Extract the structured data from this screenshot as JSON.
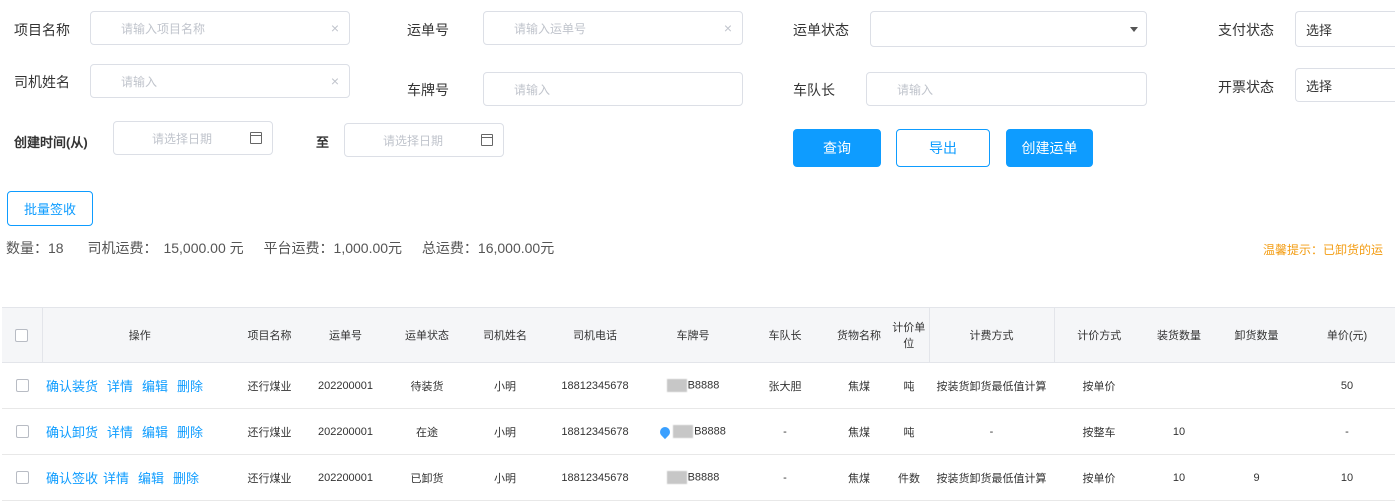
{
  "filters": {
    "project_name": {
      "label": "项目名称",
      "placeholder": "请输入项目名称"
    },
    "waybill_no": {
      "label": "运单号",
      "placeholder": "请输入运单号"
    },
    "waybill_status": {
      "label": "运单状态",
      "value": ""
    },
    "pay_status": {
      "label": "支付状态",
      "value": "选择"
    },
    "driver_name": {
      "label": "司机姓名",
      "placeholder": "请输入"
    },
    "plate_no": {
      "label": "车牌号",
      "placeholder": "请输入"
    },
    "team_leader": {
      "label": "车队长",
      "placeholder": "请输入"
    },
    "invoice_status": {
      "label": "开票状态",
      "value": "选择"
    },
    "created_from": {
      "label": "创建时间(从)",
      "placeholder": "请选择日期"
    },
    "to_label": "至",
    "created_to": {
      "placeholder": "请选择日期"
    },
    "clear_glyph": "×"
  },
  "buttons": {
    "query": "查询",
    "export": "导出",
    "create": "创建运单",
    "batch_sign": "批量签收"
  },
  "summary": {
    "count_label": "数量：",
    "count": "18",
    "driver_fee_label": "司机运费：",
    "driver_fee": "15,000.00 元",
    "platform_fee_label": "平台运费：",
    "platform_fee": "1,000.00元",
    "total_fee_label": "总运费：",
    "total_fee": "16,000.00元",
    "tip": "温馨提示：已卸货的运"
  },
  "table": {
    "columns": [
      "操作",
      "项目名称",
      "运单号",
      "运单状态",
      "司机姓名",
      "司机电话",
      "车牌号",
      "车队长",
      "货物名称",
      "计价单位",
      "计费方式",
      "计价方式",
      "装货数量",
      "卸货数量",
      "单价(元)"
    ],
    "rows": [
      {
        "actions": [
          "确认装货",
          "详情",
          "编辑",
          "删除"
        ],
        "project": "还行煤业",
        "waybill": "202200001",
        "status": "待装货",
        "driver": "小明",
        "phone": "18812345678",
        "plate": "B8888",
        "leader": "张大胆",
        "goods": "焦煤",
        "unit": "吨",
        "billing": "按装货卸货最低值计算",
        "pricing": "按单价",
        "load_qty": "",
        "unload_qty": "",
        "price": "50"
      },
      {
        "actions": [
          "确认卸货",
          "详情",
          "编辑",
          "删除"
        ],
        "project": "还行煤业",
        "waybill": "202200001",
        "status": "在途",
        "driver": "小明",
        "phone": "18812345678",
        "plate": "B8888",
        "leader": "-",
        "goods": "焦煤",
        "unit": "吨",
        "billing": "-",
        "pricing": "按整车",
        "load_qty": "10",
        "unload_qty": "",
        "price": "-"
      },
      {
        "actions": [
          "确认签收",
          "详情",
          "编辑",
          "删除"
        ],
        "project": "还行煤业",
        "waybill": "202200001",
        "status": "已卸货",
        "driver": "小明",
        "phone": "18812345678",
        "plate": "B8888",
        "leader": "-",
        "goods": "焦煤",
        "unit": "件数",
        "billing": "按装货卸货最低值计算",
        "pricing": "按单价",
        "load_qty": "10",
        "unload_qty": "9",
        "price": "10"
      }
    ]
  },
  "icons": {
    "calendar": "calendar-icon",
    "location": "location-pin-icon",
    "dropdown": "chevron-down-icon"
  },
  "colors": {
    "primary": "#0e9cff",
    "tip": "#f39c12",
    "header_bg": "#f5f6f8"
  }
}
